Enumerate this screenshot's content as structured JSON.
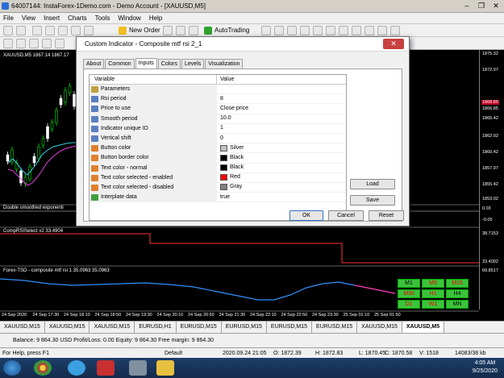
{
  "window": {
    "title": "64007144: InstaForex-1Demo.com - Demo Account - [XAUUSD,M5]"
  },
  "menu": [
    "File",
    "View",
    "Insert",
    "Charts",
    "Tools",
    "Window",
    "Help"
  ],
  "toolbar": {
    "new_order": "New Order",
    "autotrading": "AutoTrading"
  },
  "chart": {
    "symbol_label": "XAUUSD,M5 1867.14 1867.17",
    "price_labels": [
      "1875.32",
      "1872.97",
      "1868.85",
      "1866.85",
      "1865.42",
      "1862.92",
      "1860.42",
      "1857.97",
      "1855.42",
      "1853.02",
      "0.03",
      "-0.05",
      "38.7153",
      "33.4092",
      "69.8517"
    ],
    "price_highlight": "1868.85",
    "pane1_label": "Double smoothed exponenti",
    "pane2_label": "CompRSISelect v2 33.4904",
    "pane3_label": "Forex-TSD - composite mtf rsi 1 35.0963 35.0963",
    "time_labels": [
      "24 Sep 2020",
      "24 Sep 17:30",
      "24 Sep 18:10",
      "24 Sep 18:50",
      "24 Sep 19:30",
      "24 Sep 20:10",
      "24 Sep 20:50",
      "24 Sep 21:30",
      "24 Sep 22:10",
      "24 Sep 22:50",
      "24 Sep 23:30",
      "25 Sep 01:10",
      "25 Sep 01:50"
    ],
    "tf_buttons": [
      {
        "label": "M1",
        "selected": false
      },
      {
        "label": "M5",
        "selected": true
      },
      {
        "label": "M15",
        "selected": true
      },
      {
        "label": "M30",
        "selected": true
      },
      {
        "label": "H1",
        "selected": true
      },
      {
        "label": "H4",
        "selected": false
      },
      {
        "label": "D1",
        "selected": true
      },
      {
        "label": "W1",
        "selected": true
      },
      {
        "label": "MN",
        "selected": false
      }
    ]
  },
  "chart_tabs": [
    "XAUUSD,M15",
    "XAUUSD,M15",
    "XAUUSD,M15",
    "EURUSD,H1",
    "EURUSD,M15",
    "EURUSD,M15",
    "EURUSD,M15",
    "EURUSD,M15",
    "XAUUSD,M15",
    "XAUUSD,M5"
  ],
  "terminal": {
    "text": "Balance: 9 864.30 USD  Profit/Loss: 0.00  Equity: 9 864.30  Free margin: 9 864.30"
  },
  "status": {
    "help": "For Help, press F1",
    "profile": "Default",
    "datetime": "2020.09.24 21:05",
    "open": "O: 1872.39",
    "high": "H: 1872.83",
    "low": "L: 1870.45",
    "close": "C: 1870.58",
    "volume": "V: 1518",
    "traffic": "14083/38 kb"
  },
  "taskbar": {
    "time": "4:05 AM",
    "date": "9/25/2020"
  },
  "dialog": {
    "title": "Custom Indicator - Composite mtf rsi 2_1",
    "tabs": [
      "About",
      "Common",
      "Inputs",
      "Colors",
      "Levels",
      "Visualization"
    ],
    "active_tab": "Inputs",
    "columns": [
      "Variable",
      "Value"
    ],
    "rows": [
      {
        "variable": "Parameters",
        "value": "",
        "color": ""
      },
      {
        "variable": "Rsi period",
        "value": "8",
        "color": ""
      },
      {
        "variable": "Price to use",
        "value": "Close price",
        "color": ""
      },
      {
        "variable": "Smooth period",
        "value": "10.0",
        "color": ""
      },
      {
        "variable": "Indicator unique ID",
        "value": "1",
        "color": ""
      },
      {
        "variable": "Vertical shift",
        "value": "0",
        "color": ""
      },
      {
        "variable": "Button color",
        "value": "Silver",
        "color": "#c0c0c0"
      },
      {
        "variable": "Button border color",
        "value": "Black",
        "color": "#000000"
      },
      {
        "variable": "Text color - normal",
        "value": "Black",
        "color": "#000000"
      },
      {
        "variable": "Text color selected - enabled",
        "value": "Red",
        "color": "#ff0000"
      },
      {
        "variable": "Text color selected - disabled",
        "value": "Gray",
        "color": "#808080"
      },
      {
        "variable": "Interplate data",
        "value": "true",
        "color": ""
      }
    ],
    "load": "Load",
    "save": "Save",
    "ok": "OK",
    "cancel": "Cancel",
    "reset": "Reset"
  },
  "colors": {
    "tf_button_bg": "#3cc33c",
    "rsi_line": "#ff3030",
    "tsd_line_up": "#3090ff",
    "tsd_line_down": "#ff40c0"
  }
}
